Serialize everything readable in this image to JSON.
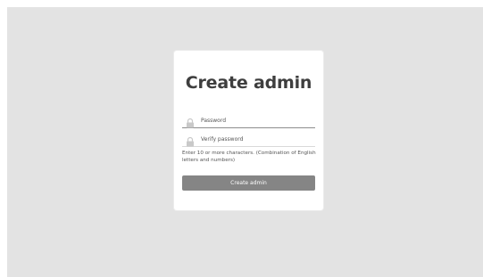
{
  "form": {
    "title": "Create admin",
    "password_placeholder": "Password",
    "verify_placeholder": "Verify password",
    "hint": "Enter 10 or more characters. (Combination of English letters and numbers)",
    "submit_label": "Create admin"
  },
  "icons": {
    "password_icon": "lock-icon",
    "verify_icon": "lock-icon"
  },
  "colors": {
    "background": "#e3e3e3",
    "card": "#ffffff",
    "button": "#858585",
    "button_text": "#ffffff"
  }
}
